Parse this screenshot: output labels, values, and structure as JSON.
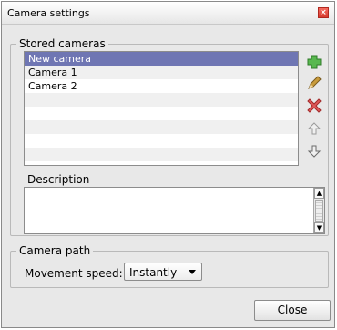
{
  "window": {
    "title": "Camera settings"
  },
  "stored": {
    "legend": "Stored cameras",
    "items": [
      "New camera",
      "Camera 1",
      "Camera 2"
    ],
    "selected_index": 0
  },
  "toolbar": {
    "add_icon": "add-icon",
    "edit_icon": "pencil-icon",
    "delete_icon": "delete-icon",
    "move_up_icon": "arrow-up-icon",
    "move_down_icon": "arrow-down-icon"
  },
  "description": {
    "label": "Description",
    "value": ""
  },
  "camera_path": {
    "legend": "Camera path",
    "speed_label": "Movement speed:",
    "speed_value": "Instantly"
  },
  "buttons": {
    "close": "Close"
  },
  "colors": {
    "selection": "#6f76b3",
    "add": "#2f9a2f",
    "delete": "#d43a3a"
  }
}
